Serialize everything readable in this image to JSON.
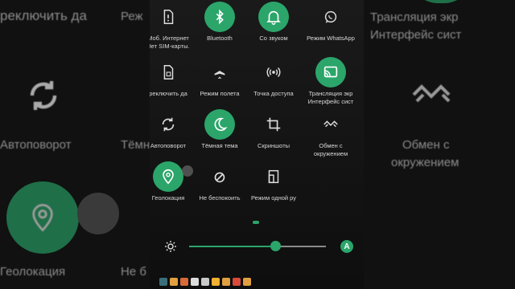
{
  "background": {
    "left": {
      "row1_text": "реключить да",
      "autorotate": "Автоповорот",
      "geolocation": "Геолокация"
    },
    "right": {
      "row1_line1": "Трансляция экр",
      "row1_line2": "Интерфейс сист",
      "exchange_line1": "Обмен с",
      "exchange_line2": "окружением"
    },
    "center_edge": {
      "row1": "Реж",
      "dark_theme": "Тёмная тема",
      "nb": "Не б"
    }
  },
  "tiles": [
    {
      "id": "mobile-internet",
      "l1": "Моб. Интернет",
      "l2": "Нет SIM-карты.",
      "state": "off",
      "icon": "sim-alert-icon"
    },
    {
      "id": "bluetooth",
      "l1": "Bluetooth",
      "l2": "",
      "state": "on",
      "icon": "bluetooth-icon"
    },
    {
      "id": "sound",
      "l1": "Со звуком",
      "l2": "",
      "state": "on",
      "icon": "bell-icon"
    },
    {
      "id": "whatsapp",
      "l1": "Режим WhatsApp",
      "l2": "",
      "state": "off",
      "icon": "whatsapp-icon"
    },
    {
      "id": "switch-data",
      "l1": "реключить да",
      "l2": "",
      "state": "off",
      "icon": "sim-icon"
    },
    {
      "id": "airplane",
      "l1": "Режим полета",
      "l2": "",
      "state": "off",
      "icon": "airplane-icon"
    },
    {
      "id": "hotspot",
      "l1": "Точка доступа",
      "l2": "",
      "state": "off",
      "icon": "hotspot-icon"
    },
    {
      "id": "cast",
      "l1": "Трансляция экр",
      "l2": "Интерфейс сист",
      "state": "on",
      "icon": "cast-icon"
    },
    {
      "id": "autorotate",
      "l1": "Автоповорот",
      "l2": "",
      "state": "off",
      "icon": "rotate-icon"
    },
    {
      "id": "dark-theme",
      "l1": "Тёмная тема",
      "l2": "",
      "state": "on",
      "icon": "moon-icon"
    },
    {
      "id": "screenshot",
      "l1": "Скриншоты",
      "l2": "",
      "state": "off",
      "icon": "crop-icon"
    },
    {
      "id": "nearby-share",
      "l1": "Обмен с",
      "l2": "окружением",
      "state": "off",
      "icon": "nearby-icon"
    },
    {
      "id": "geolocation",
      "l1": "Геолокация",
      "l2": "",
      "state": "on",
      "icon": "location-icon"
    },
    {
      "id": "dnd",
      "l1": "Не беспокоить",
      "l2": "",
      "state": "off",
      "icon": "dnd-icon"
    },
    {
      "id": "one-hand",
      "l1": "Режим одной ру",
      "l2": "",
      "state": "off",
      "icon": "one-hand-icon"
    }
  ],
  "brightness": {
    "level": 0.63,
    "auto_label": "A"
  },
  "colors": {
    "accent": "#2ba56a",
    "panel": "#151515"
  }
}
